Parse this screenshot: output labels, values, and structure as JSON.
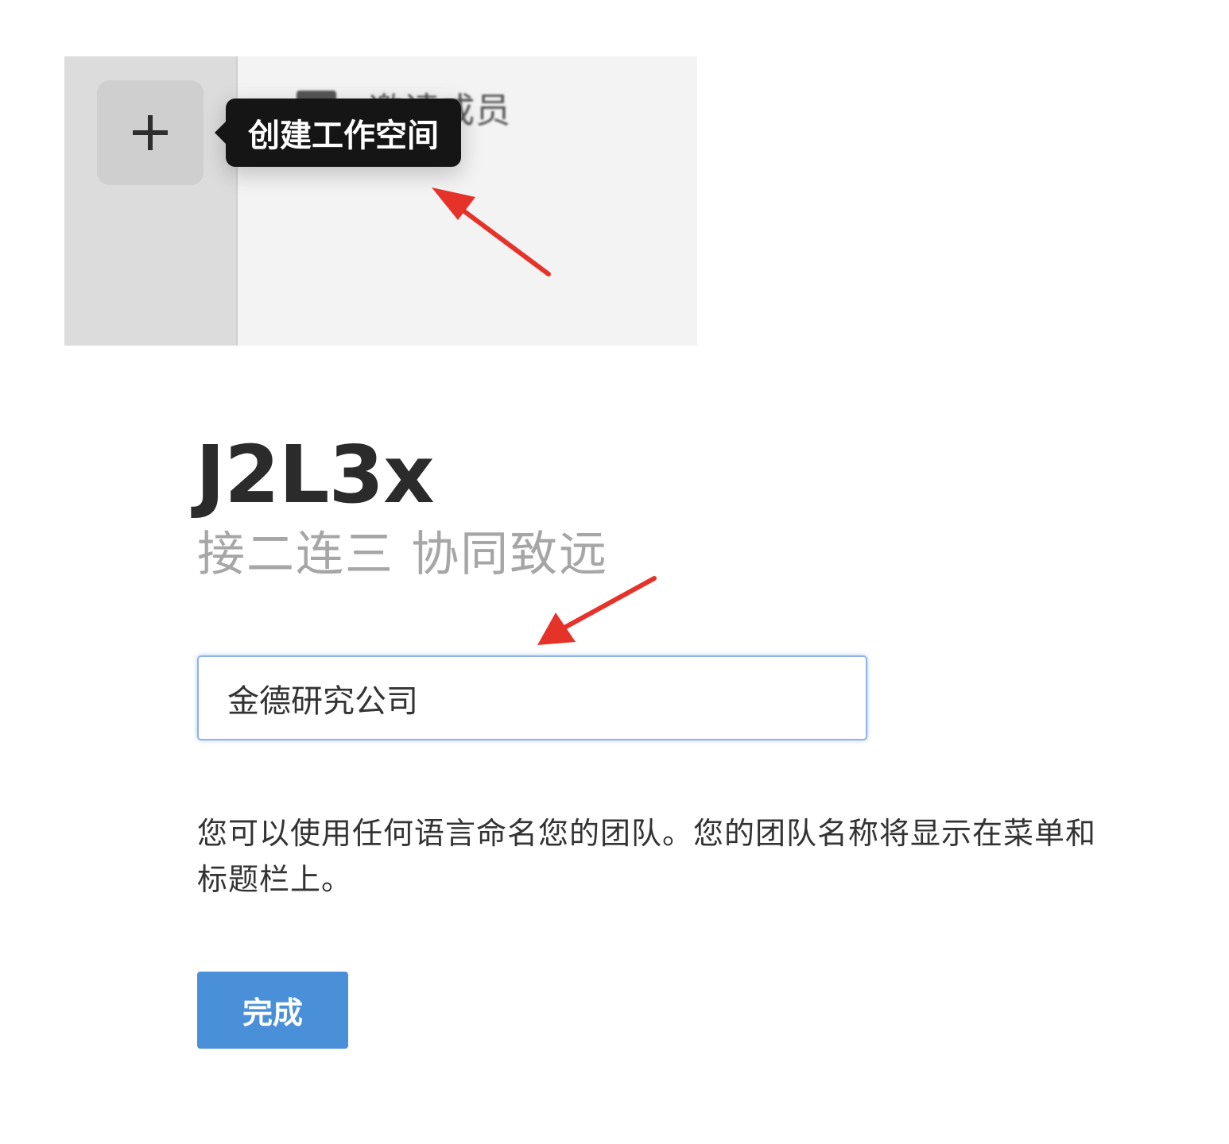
{
  "sidebar": {
    "add_workspace_icon": "plus-icon",
    "tooltip_text": "创建工作空间",
    "invite_item": {
      "icon": "add-member-icon",
      "label": "邀请成员"
    }
  },
  "brand": {
    "title": "J2L3x",
    "slogan": "接二连三 协同致远"
  },
  "form": {
    "team_name_value": "金德研究公司",
    "helper_text": "您可以使用任何语言命名您的团队。您的团队名称将显示在菜单和标题栏上。",
    "done_label": "完成"
  },
  "colors": {
    "accent": "#4a90d9",
    "tooltip_bg": "#151515",
    "annotation_arrow": "#e5332a",
    "rail_bg": "#dcdcdc",
    "panel_bg": "#f3f3f3"
  }
}
